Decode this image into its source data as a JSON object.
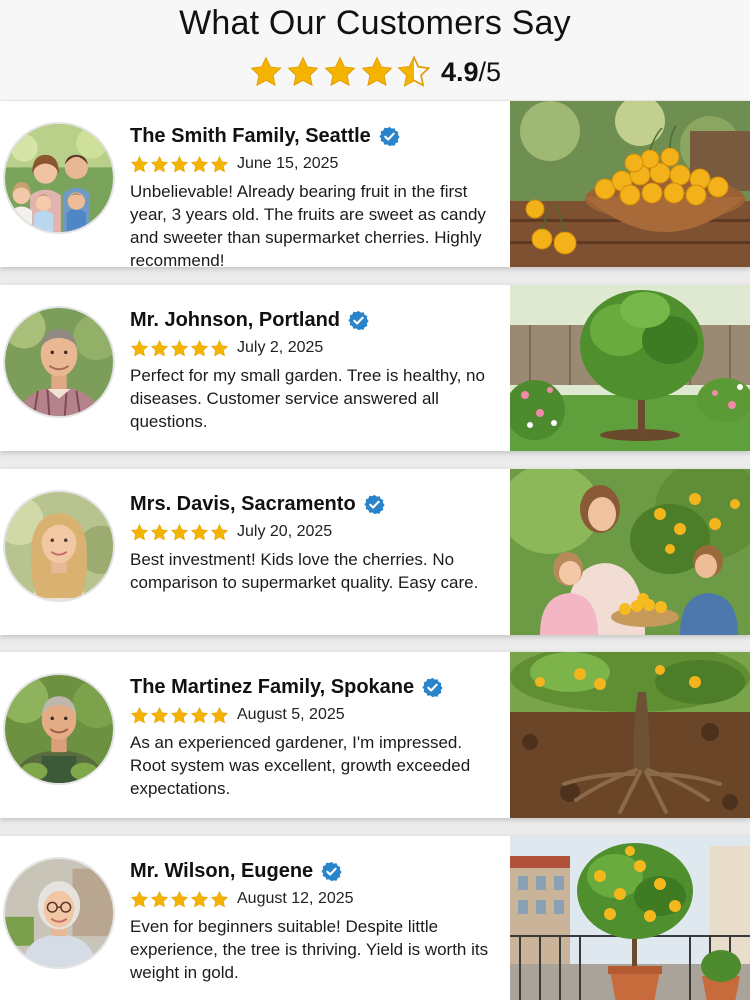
{
  "header": {
    "title": "What Our Customers Say",
    "overall_rating": "4.9",
    "overall_max": "/5",
    "overall_stars": 4.5
  },
  "colors": {
    "star": "#f5b301",
    "verified": "#2a84c9",
    "card_bg": "#ffffff",
    "page_bg": "#ececec"
  },
  "reviews": [
    {
      "name": "The Smith Family, Seattle",
      "date": "June 15, 2025",
      "stars": 5,
      "text": "Unbelievable! Already bearing fruit in the first year, 3 years old. The fruits are sweet as candy and sweeter than supermarket cherries. Highly recommend!",
      "avatar_icon": "family-photo-icon",
      "photo_icon": "cherry-bowl-photo-icon"
    },
    {
      "name": "Mr. Johnson, Portland",
      "date": "July 2, 2025",
      "stars": 5,
      "text": "Perfect for my small garden. Tree is healthy, no diseases. Customer service answered all questions.",
      "avatar_icon": "man-portrait-icon",
      "photo_icon": "garden-tree-photo-icon"
    },
    {
      "name": "Mrs. Davis, Sacramento",
      "date": "July 20, 2025",
      "stars": 5,
      "text": "Best investment! Kids love the cherries. No comparison to supermarket quality. Easy care.",
      "avatar_icon": "woman-portrait-icon",
      "photo_icon": "harvest-family-photo-icon"
    },
    {
      "name": "The Martinez Family, Spokane",
      "date": "August 5, 2025",
      "stars": 5,
      "text": "As an experienced gardener, I'm impressed. Root system was excellent, growth exceeded expectations.",
      "avatar_icon": "gardener-portrait-icon",
      "photo_icon": "tree-roots-photo-icon"
    },
    {
      "name": "Mr. Wilson, Eugene",
      "date": "August 12, 2025",
      "stars": 5,
      "text": "Even for beginners suitable! Despite little experience, the tree is thriving. Yield is worth its weight in gold.",
      "avatar_icon": "senior-woman-portrait-icon",
      "photo_icon": "balcony-potted-tree-photo-icon"
    }
  ]
}
